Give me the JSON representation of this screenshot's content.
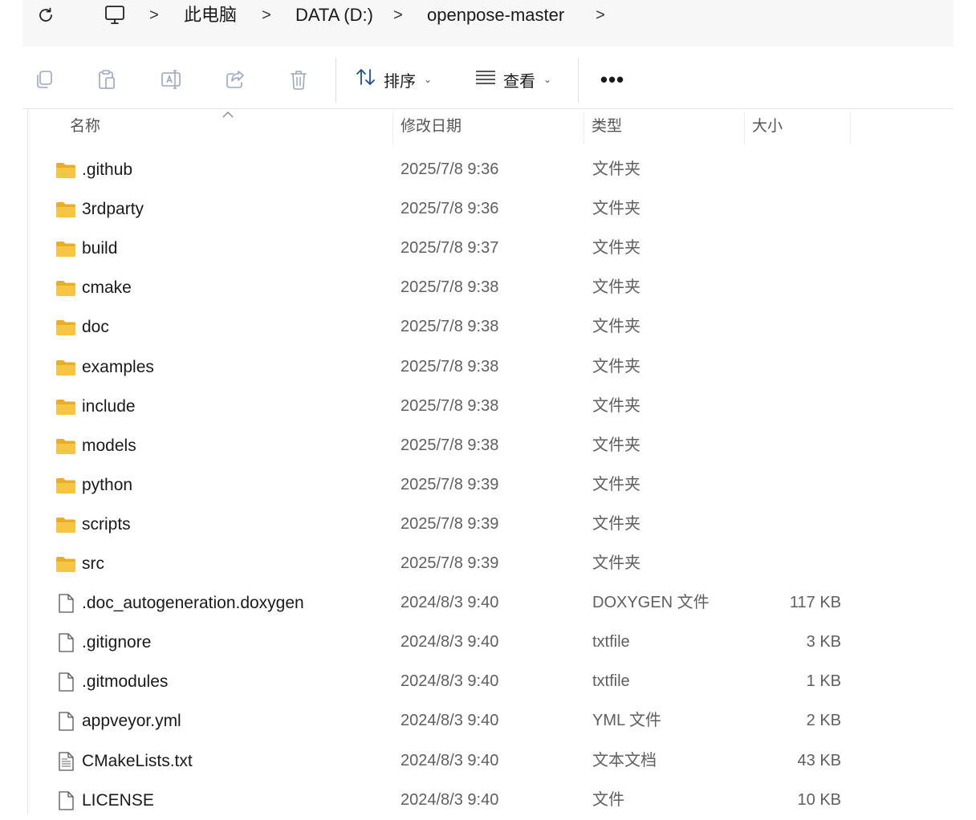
{
  "address": {
    "crumbs": [
      "此电脑",
      "DATA (D:)",
      "openpose-master"
    ],
    "separator": ">"
  },
  "toolbar": {
    "buttons": [
      "copy-icon",
      "paste-icon",
      "rename-icon",
      "share-icon",
      "delete-icon"
    ],
    "sort_label": "排序",
    "view_label": "查看",
    "more_label": "•••"
  },
  "columns": {
    "name": "名称",
    "date": "修改日期",
    "type": "类型",
    "size": "大小"
  },
  "files": [
    {
      "name": ".github",
      "date": "2025/7/8 9:36",
      "type": "文件夹",
      "size": "",
      "icon": "folder-icon"
    },
    {
      "name": "3rdparty",
      "date": "2025/7/8 9:36",
      "type": "文件夹",
      "size": "",
      "icon": "folder-icon"
    },
    {
      "name": "build",
      "date": "2025/7/8 9:37",
      "type": "文件夹",
      "size": "",
      "icon": "folder-icon"
    },
    {
      "name": "cmake",
      "date": "2025/7/8 9:38",
      "type": "文件夹",
      "size": "",
      "icon": "folder-icon"
    },
    {
      "name": "doc",
      "date": "2025/7/8 9:38",
      "type": "文件夹",
      "size": "",
      "icon": "folder-icon"
    },
    {
      "name": "examples",
      "date": "2025/7/8 9:38",
      "type": "文件夹",
      "size": "",
      "icon": "folder-icon"
    },
    {
      "name": "include",
      "date": "2025/7/8 9:38",
      "type": "文件夹",
      "size": "",
      "icon": "folder-icon"
    },
    {
      "name": "models",
      "date": "2025/7/8 9:38",
      "type": "文件夹",
      "size": "",
      "icon": "folder-icon"
    },
    {
      "name": "python",
      "date": "2025/7/8 9:39",
      "type": "文件夹",
      "size": "",
      "icon": "folder-icon"
    },
    {
      "name": "scripts",
      "date": "2025/7/8 9:39",
      "type": "文件夹",
      "size": "",
      "icon": "folder-icon"
    },
    {
      "name": "src",
      "date": "2025/7/8 9:39",
      "type": "文件夹",
      "size": "",
      "icon": "folder-icon"
    },
    {
      "name": ".doc_autogeneration.doxygen",
      "date": "2024/8/3 9:40",
      "type": "DOXYGEN 文件",
      "size": "117 KB",
      "icon": "file-icon"
    },
    {
      "name": ".gitignore",
      "date": "2024/8/3 9:40",
      "type": "txtfile",
      "size": "3 KB",
      "icon": "file-icon"
    },
    {
      "name": ".gitmodules",
      "date": "2024/8/3 9:40",
      "type": "txtfile",
      "size": "1 KB",
      "icon": "file-icon"
    },
    {
      "name": "appveyor.yml",
      "date": "2024/8/3 9:40",
      "type": "YML 文件",
      "size": "2 KB",
      "icon": "file-icon"
    },
    {
      "name": "CMakeLists.txt",
      "date": "2024/8/3 9:40",
      "type": "文本文档",
      "size": "43 KB",
      "icon": "text-file-icon"
    },
    {
      "name": "LICENSE",
      "date": "2024/8/3 9:40",
      "type": "文件",
      "size": "10 KB",
      "icon": "file-icon"
    }
  ],
  "colors": {
    "folder": "#f6c544",
    "folder_dark": "#e8ae26",
    "text_secondary": "#5f5f5f",
    "addressbar_bg": "#f7f7f7"
  }
}
